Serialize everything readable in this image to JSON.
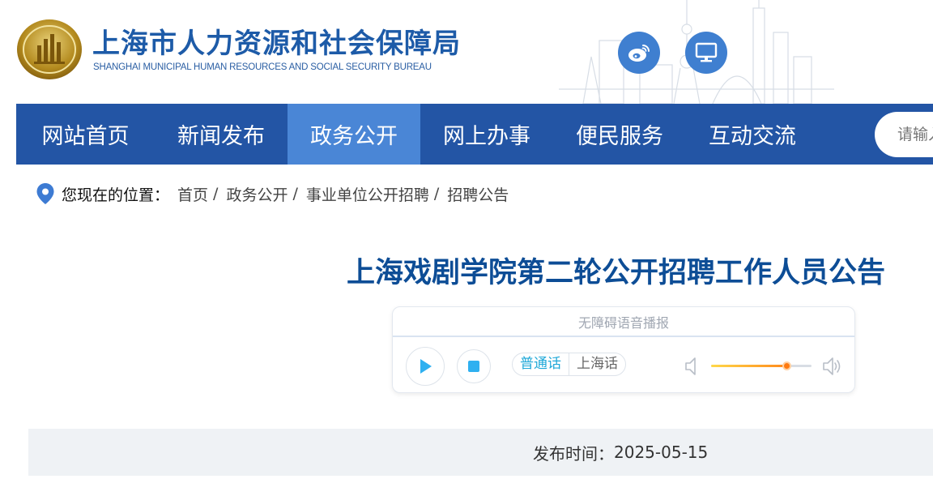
{
  "header": {
    "site_title": "上海市人力资源和社会保障局",
    "site_subtitle": "SHANGHAI MUNICIPAL HUMAN RESOURCES AND SOCIAL SECURITY BUREAU",
    "emblem_icon": "government-emblem-icon",
    "social_buttons": [
      {
        "icon": "weibo-icon"
      },
      {
        "icon": "desktop-monitor-icon"
      }
    ],
    "accent_color": "#1d5ba8"
  },
  "nav": {
    "items": [
      {
        "label": "网站首页",
        "active": false
      },
      {
        "label": "新闻发布",
        "active": false
      },
      {
        "label": "政务公开",
        "active": true
      },
      {
        "label": "网上办事",
        "active": false
      },
      {
        "label": "便民服务",
        "active": false
      },
      {
        "label": "互动交流",
        "active": false
      }
    ],
    "search_placeholder": "请输入关键字",
    "bg_color": "#2355a5",
    "active_color": "#4a86d6"
  },
  "breadcrumb": {
    "icon": "location-pin-icon",
    "label": "您现在的位置：",
    "items": [
      "首页",
      "政务公开",
      "事业单位公开招聘",
      "招聘公告"
    ],
    "separator": "/"
  },
  "article": {
    "title": "上海戏剧学院第二轮公开招聘工作人员公告",
    "publish_label": "发布时间：",
    "publish_date": "2025-05-15"
  },
  "player": {
    "header": "无障碍语音播报",
    "languages": [
      "普通话",
      "上海话"
    ],
    "selected_language": "普通话",
    "volume": 0.75,
    "play_icon": "play-icon",
    "stop_icon": "stop-icon",
    "volume_low_icon": "volume-low-icon",
    "volume_high_icon": "volume-high-icon"
  }
}
